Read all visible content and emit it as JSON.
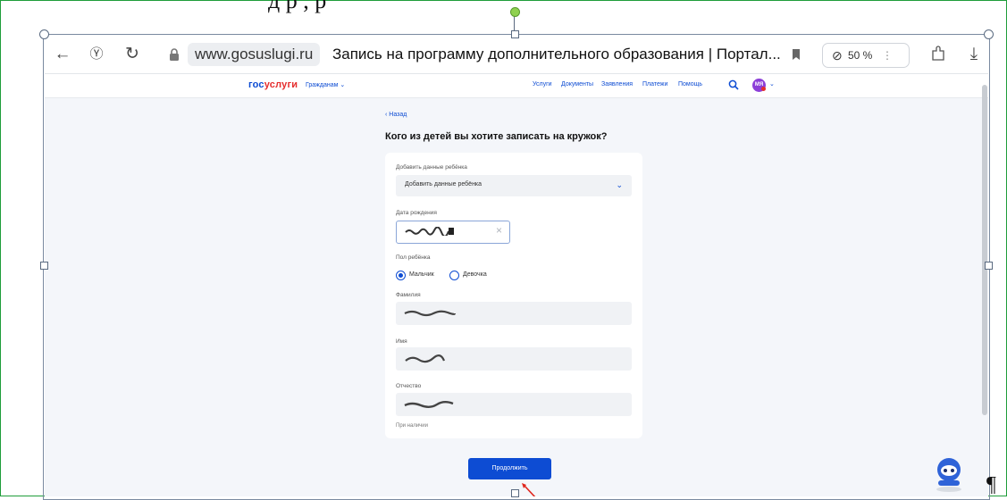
{
  "document": {
    "partial_heading": "д                    р         ,           р",
    "pilcrow": "¶"
  },
  "browser": {
    "domain": "www.gosuslugi.ru",
    "tab_title": "Запись на программу дополнительного образования | Портал...",
    "zoom": "50 %",
    "icons": [
      "back-arrow-icon",
      "yandex-icon",
      "reload-icon",
      "lock-icon",
      "bookmark-icon",
      "zoom-icon",
      "more-icon",
      "extensions-icon",
      "download-icon"
    ]
  },
  "header": {
    "logo_part1": "гос",
    "logo_part2": "услуги",
    "audience": "Гражданам ⌄",
    "nav": [
      "Услуги",
      "Документы",
      "Заявления",
      "Платежи",
      "Помощь"
    ],
    "avatar": "МЯ"
  },
  "page": {
    "back": "‹ Назад",
    "title": "Кого из детей вы хотите записать на кружок?",
    "child_label": "Добавить данные ребёнка",
    "child_value": "Добавить данные ребёнка",
    "birth_label": "Дата рождения",
    "gender_label": "Пол ребёнка",
    "gender_options": [
      "Мальчик",
      "Девочка"
    ],
    "gender_selected": "Мальчик",
    "surname_label": "Фамилия",
    "name_label": "Имя",
    "patronymic_label": "Отчество",
    "patronymic_hint": "При наличии",
    "continue": "Продолжить"
  },
  "colors": {
    "brand_blue": "#0d4cd3",
    "brand_red": "#e52d2d",
    "page_bg": "#f4f6fa",
    "frame_green": "#1f9d3a"
  }
}
